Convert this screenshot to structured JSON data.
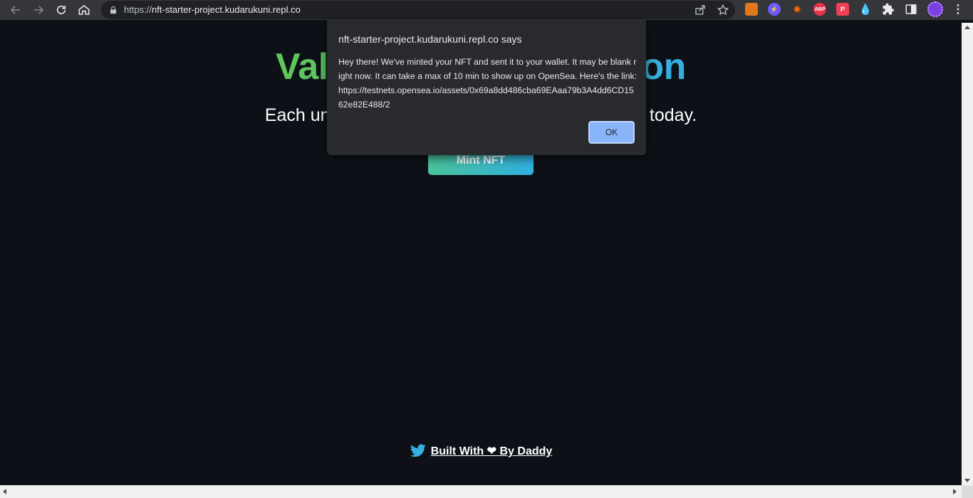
{
  "browser": {
    "url_scheme": "https://",
    "url_host": "nft-starter-project.kudarukuni.repl.co",
    "extensions": [
      {
        "name": "metamask-extension",
        "label": ""
      },
      {
        "name": "lightning-extension",
        "label": ""
      },
      {
        "name": "spark-extension",
        "label": ""
      },
      {
        "name": "adblock-plus-extension",
        "label": "ABP"
      },
      {
        "name": "pocket-extension",
        "label": ""
      },
      {
        "name": "drop-extension",
        "label": ""
      }
    ]
  },
  "page": {
    "title": "Valeny's NFT Collection",
    "subtitle": "Each unique. Each beautiful. Discover your NFT today.",
    "mint_button": "Mint NFT",
    "footer_link": "Built With ❤ By Daddy"
  },
  "dialog": {
    "title": "nft-starter-project.kudarukuni.repl.co says",
    "message": "Hey there! We've minted your NFT and sent it to your wallet. It may be blank right now. It can take a max of 10 min to show up on OpenSea. Here's the link: https://testnets.opensea.io/assets/0x69a8dd486cba69EAaa79b3A4dd6CD1562e82E488/2",
    "ok_label": "OK"
  },
  "colors": {
    "page_bg": "#0d1117",
    "gradient_start": "#60c657",
    "gradient_end": "#35aee2",
    "dialog_bg": "#292a2d",
    "ok_button": "#8ab4f8"
  }
}
